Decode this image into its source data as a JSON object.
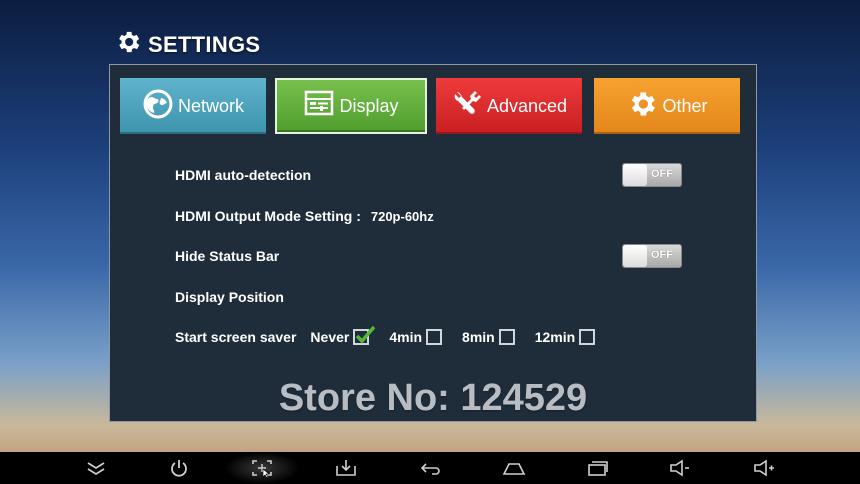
{
  "header": {
    "title": "SETTINGS",
    "icon": "gear-icon"
  },
  "tabs": [
    {
      "label": "Network",
      "icon": "globe-icon",
      "color": "#4aa2bd"
    },
    {
      "label": "Display",
      "icon": "sliders-icon",
      "color": "#62ae3c",
      "active": true
    },
    {
      "label": "Advanced",
      "icon": "tools-icon",
      "color": "#db2b2d"
    },
    {
      "label": "Other",
      "icon": "gear-icon",
      "color": "#ee9425"
    }
  ],
  "settings": {
    "hdmi_auto": {
      "label": "HDMI auto-detection",
      "toggle": "OFF"
    },
    "hdmi_output": {
      "label": "HDMI Output Mode Setting :",
      "value": "720p-60hz"
    },
    "hide_status": {
      "label": "Hide Status Bar",
      "toggle": "OFF"
    },
    "display_position": {
      "label": "Display Position"
    },
    "screensaver": {
      "label": "Start screen saver",
      "options": [
        {
          "label": "Never",
          "checked": true
        },
        {
          "label": "4min",
          "checked": false
        },
        {
          "label": "8min",
          "checked": false
        },
        {
          "label": "12min",
          "checked": false
        }
      ]
    }
  },
  "watermark": "Store No: 124529",
  "navbar": {
    "buttons": [
      "hide-bar-icon",
      "power-icon",
      "screenshot-icon",
      "download-icon",
      "back-icon",
      "home-icon",
      "recent-apps-icon",
      "volume-down-icon",
      "volume-up-icon"
    ]
  }
}
